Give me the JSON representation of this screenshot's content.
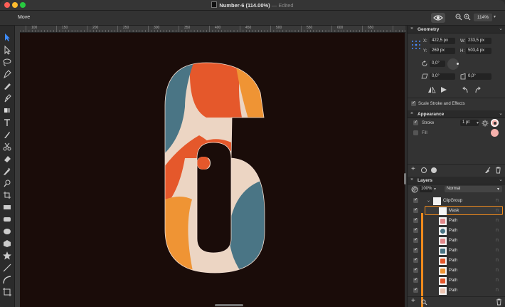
{
  "window": {
    "title": "Number-6 (114.00%)",
    "edited": "— Edited",
    "traffic_lights": [
      "#fe5f57",
      "#febc2e",
      "#28c840"
    ]
  },
  "toolbar": {
    "tool_name": "Move",
    "zoom": "114%"
  },
  "rulers": {
    "top_labels": [
      "100",
      "150",
      "200",
      "250",
      "300",
      "350",
      "400",
      "450",
      "500",
      "550",
      "600",
      "650"
    ]
  },
  "artwork": {
    "colors": {
      "background": "#1a0c09",
      "blue": "#4a7585",
      "orange": "#e5582b",
      "light_orange": "#ef9434",
      "cream": "#ecd5c3"
    }
  },
  "geometry": {
    "title": "Geometry",
    "x_label": "X:",
    "x": "422,5 px",
    "y_label": "Y:",
    "y": "269 px",
    "w_label": "W:",
    "w": "233,5 px",
    "h_label": "H:",
    "h": "503,4 px",
    "rotation": "0,0°",
    "shear": "0,0°",
    "shear2": "0,0°",
    "scale_stroke_label": "Scale Stroke and Effects"
  },
  "appearance": {
    "title": "Appearance",
    "stroke_label": "Stroke",
    "stroke_value": "1 pt",
    "fill_label": "Fill",
    "stroke_color": "#f6b2ad",
    "fill_color": "#f6b2ad"
  },
  "layers": {
    "title": "Layers",
    "opacity": "100%",
    "blend_mode": "Normal",
    "group_name": "ClipGroup",
    "items": [
      {
        "name": "Mask",
        "thumb": "#f4f4f4"
      },
      {
        "name": "Path",
        "thumb": "#e2888a"
      },
      {
        "name": "Path",
        "thumb": "#4a7585"
      },
      {
        "name": "Path",
        "thumb": "#e2888a"
      },
      {
        "name": "Path",
        "thumb": "#4a7585"
      },
      {
        "name": "Path",
        "thumb": "#e5582b"
      },
      {
        "name": "Path",
        "thumb": "#ef9434"
      },
      {
        "name": "Path",
        "thumb": "#e5582b"
      },
      {
        "name": "Path",
        "thumb": "#ecc3b0"
      }
    ]
  }
}
